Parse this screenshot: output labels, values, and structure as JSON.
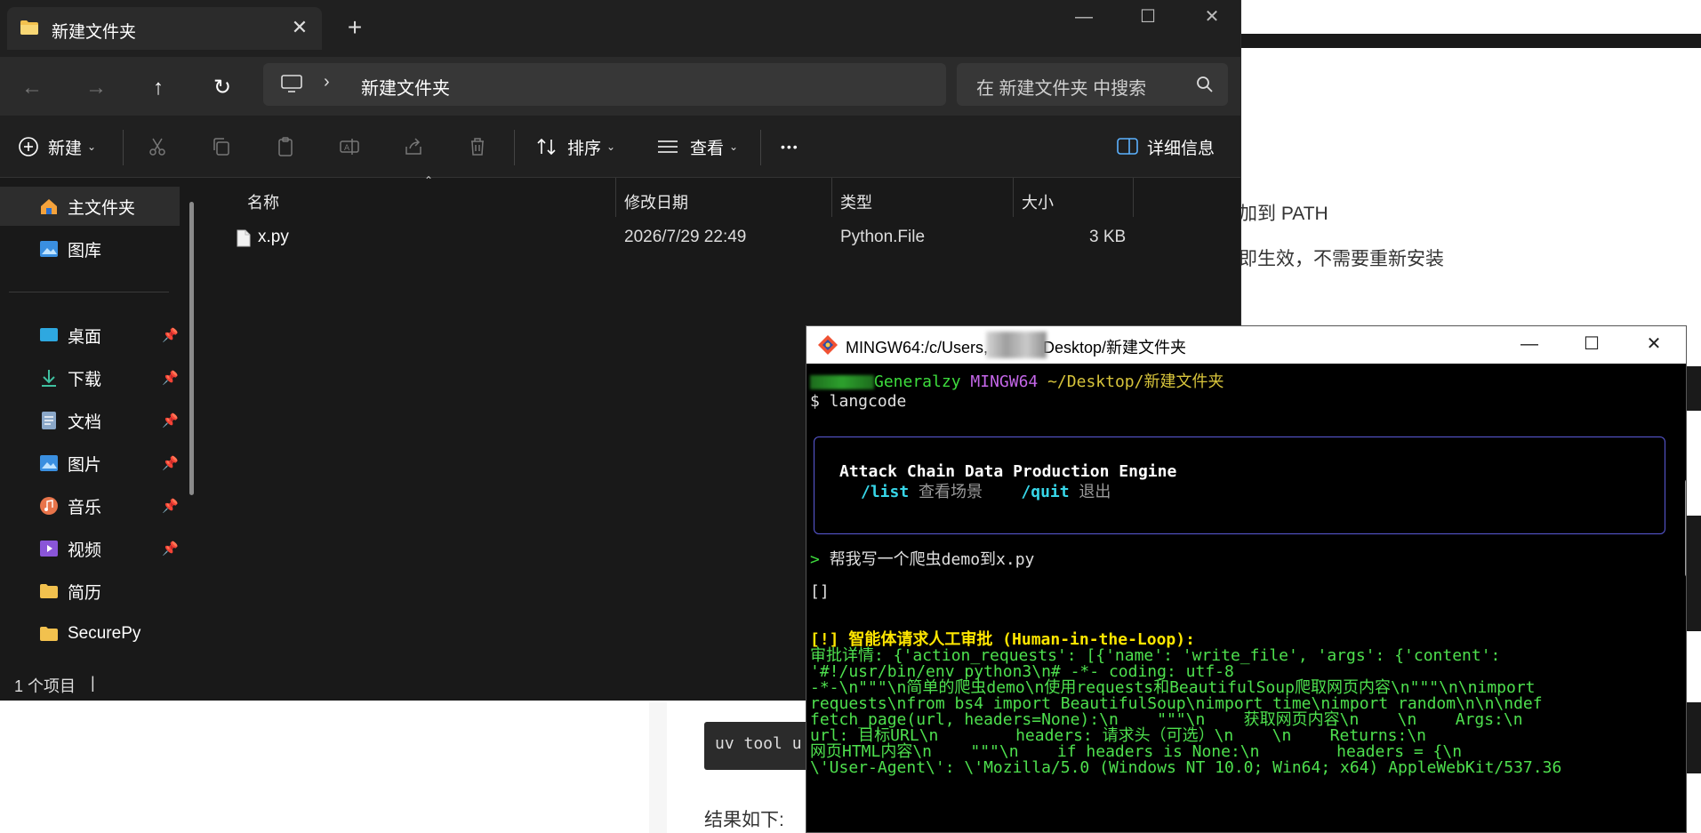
{
  "background_doc": {
    "line1": "加到 PATH",
    "line2": "即生效，不需要重新安装",
    "code": "uv tool u",
    "result_label": "结果如下:"
  },
  "explorer": {
    "tab_title": "新建文件夹",
    "tab_close": "✕",
    "new_tab": "+",
    "window_controls": {
      "minimize": "—",
      "maximize": "☐",
      "close": "✕"
    },
    "nav": {
      "back": "←",
      "forward": "→",
      "up": "↑",
      "refresh": "↻"
    },
    "address": {
      "chevron": "›",
      "path": "新建文件夹"
    },
    "search": {
      "placeholder": "在 新建文件夹 中搜索"
    },
    "toolbar": {
      "new_label": "新建",
      "sort_label": "排序",
      "view_label": "查看",
      "more_label": "•••",
      "details_label": "详细信息"
    },
    "sidebar": {
      "items": [
        {
          "label": "主文件夹",
          "icon": "home-icon",
          "pinned": false
        },
        {
          "label": "图库",
          "icon": "gallery-icon",
          "pinned": false
        },
        {
          "label": "桌面",
          "icon": "desktop-icon",
          "pinned": true
        },
        {
          "label": "下载",
          "icon": "download-icon",
          "pinned": true
        },
        {
          "label": "文档",
          "icon": "documents-icon",
          "pinned": true
        },
        {
          "label": "图片",
          "icon": "pictures-icon",
          "pinned": true
        },
        {
          "label": "音乐",
          "icon": "music-icon",
          "pinned": true
        },
        {
          "label": "视频",
          "icon": "videos-icon",
          "pinned": true
        },
        {
          "label": "简历",
          "icon": "folder-icon",
          "pinned": false
        },
        {
          "label": "SecurePy",
          "icon": "folder-icon",
          "pinned": false
        }
      ]
    },
    "columns": {
      "name": "名称",
      "modified": "修改日期",
      "type": "类型",
      "size": "大小"
    },
    "files": [
      {
        "name": "x.py",
        "modified": "2026/7/29 22:49",
        "type": "Python.File",
        "size": "3 KB"
      }
    ],
    "status": {
      "count": "1 个项目",
      "cursor": "|"
    }
  },
  "terminal": {
    "title_prefix": "MINGW64:/c/Users,",
    "title_suffix": "Desktop/新建文件夹",
    "controls": {
      "minimize": "—",
      "maximize": "☐",
      "close": "✕"
    },
    "prompt": {
      "host": "Generalzy",
      "env": "MINGW64",
      "path": "~/Desktop/新建文件夹"
    },
    "command": "$ langcode",
    "banner": {
      "title": "Attack Chain Data Production Engine",
      "list_cmd": "/list",
      "list_desc": "查看场景",
      "quit_cmd": "/quit",
      "quit_desc": "退出"
    },
    "user_prompt_marker": ">",
    "user_input": "帮我写一个爬虫demo到x.py",
    "empty_list": "[]",
    "warning": "[!] 智能体请求人工审批 (Human-in-the-Loop):",
    "detail_lines": [
      "审批详情: {'action_requests': [{'name': 'write_file', 'args': {'content':",
      "'#!/usr/bin/env python3\\n# -*- coding: utf-8",
      "-*-\\n\"\"\"\\n简单的爬虫demo\\n使用requests和BeautifulSoup爬取网页内容\\n\"\"\"\\n\\nimport",
      "requests\\nfrom bs4 import BeautifulSoup\\nimport time\\nimport random\\n\\n\\ndef",
      "fetch_page(url, headers=None):\\n    \"\"\"\\n    获取网页内容\\n    \\n    Args:\\n",
      "url: 目标URL\\n        headers: 请求头（可选）\\n    \\n    Returns:\\n",
      "网页HTML内容\\n    \"\"\"\\n    if headers is None:\\n        headers = {\\n",
      "\\'User-Agent\\': \\'Mozilla/5.0 (Windows NT 10.0; Win64; x64) AppleWebKit/537.36"
    ]
  }
}
